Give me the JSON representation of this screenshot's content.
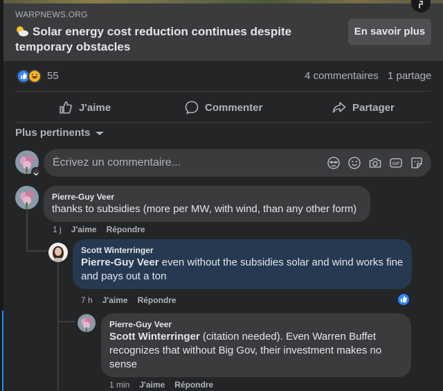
{
  "link_card": {
    "domain": "WARPNEWS.ORG",
    "headline": "Solar energy cost reduction continues despite temporary obstacles",
    "learn_more": "En savoir plus"
  },
  "stats": {
    "reaction_count": "55",
    "comments": "4 commentaires",
    "shares": "1 partage"
  },
  "actions": {
    "like": "J'aime",
    "comment": "Commenter",
    "share": "Partager"
  },
  "sort_label": "Plus pertinents",
  "composer": {
    "placeholder": "Écrivez un commentaire..."
  },
  "comments": [
    {
      "author": "Pierre-Guy Veer",
      "mention": "",
      "text": "thanks to subsidies (more per MW, with wind, than any other form)",
      "time": "1 j",
      "like": "J'aime",
      "reply": "Répondre"
    },
    {
      "author": "Scott Winterringer",
      "mention": "Pierre-Guy Veer",
      "text": " even without the subsidies solar and wind works fine and pays out a ton",
      "time": "7 h",
      "like": "J'aime",
      "reply": "Répondre"
    },
    {
      "author": "Pierre-Guy Veer",
      "mention": "Scott Winterringer",
      "text": " (citation needed). Even Warren Buffet recognizes that without Big Gov, their investment makes no sense",
      "time": "1 min",
      "like": "J'aime",
      "reply": "Répondre"
    }
  ],
  "colors": {
    "background": "#242526",
    "card": "#3a3b3c",
    "highlight_bubble": "#263951",
    "accent": "#2d88ff"
  }
}
